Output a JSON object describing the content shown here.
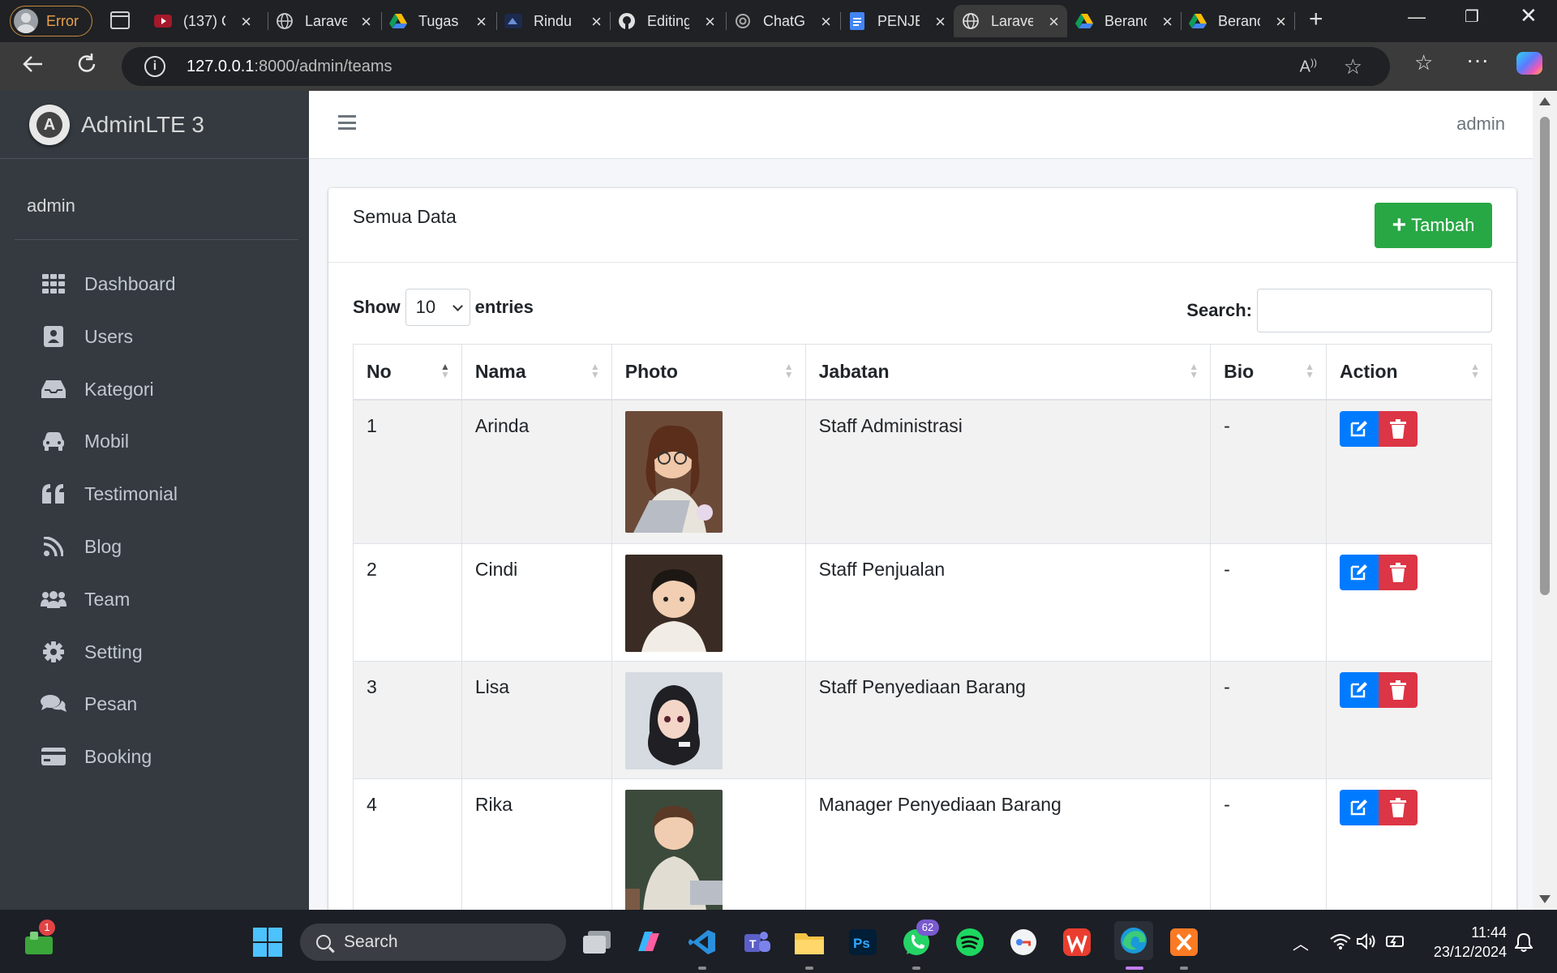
{
  "browser": {
    "profile_label": "Error",
    "tabs": [
      {
        "title": "(137) C",
        "favicon": "youtube-icon"
      },
      {
        "title": "Laravel",
        "favicon": "globe-icon"
      },
      {
        "title": "Tugas",
        "favicon": "drive-icon"
      },
      {
        "title": "Rindu",
        "favicon": "site-icon"
      },
      {
        "title": "Editing",
        "favicon": "github-icon"
      },
      {
        "title": "ChatG",
        "favicon": "chatgpt-icon"
      },
      {
        "title": "PENJE",
        "favicon": "docs-icon"
      },
      {
        "title": "Laravel",
        "favicon": "globe-icon",
        "active": true
      },
      {
        "title": "Beranda",
        "favicon": "drive-icon"
      },
      {
        "title": "Beranda",
        "favicon": "drive-icon"
      }
    ],
    "url_host": "127.0.0.1",
    "url_path": ":8000/admin/teams"
  },
  "app": {
    "brand": "AdminLTE 3",
    "sidebar_user": "admin",
    "nav_user": "admin",
    "nav": [
      {
        "label": "Dashboard",
        "icon": "dashboard-icon"
      },
      {
        "label": "Users",
        "icon": "user-card-icon"
      },
      {
        "label": "Kategori",
        "icon": "inbox-icon"
      },
      {
        "label": "Mobil",
        "icon": "car-icon"
      },
      {
        "label": "Testimonial",
        "icon": "quote-icon"
      },
      {
        "label": "Blog",
        "icon": "rss-icon"
      },
      {
        "label": "Team",
        "icon": "users-icon"
      },
      {
        "label": "Setting",
        "icon": "gear-icon"
      },
      {
        "label": "Pesan",
        "icon": "comments-icon"
      },
      {
        "label": "Booking",
        "icon": "credit-card-icon"
      }
    ]
  },
  "card": {
    "title": "Semua Data",
    "add_label": "Tambah",
    "show_label": "Show",
    "entries_value": "10",
    "entries_label": "entries",
    "search_label": "Search:",
    "search_value": ""
  },
  "table": {
    "headers": [
      "No",
      "Nama",
      "Photo",
      "Jabatan",
      "Bio",
      "Action"
    ],
    "rows": [
      {
        "no": "1",
        "nama": "Arinda",
        "jabatan": "Staff Administrasi",
        "bio": "-"
      },
      {
        "no": "2",
        "nama": "Cindi",
        "jabatan": "Staff Penjualan",
        "bio": "-"
      },
      {
        "no": "3",
        "nama": "Lisa",
        "jabatan": "Staff Penyediaan Barang",
        "bio": "-"
      },
      {
        "no": "4",
        "nama": "Rika",
        "jabatan": "Manager Penyediaan Barang",
        "bio": "-"
      }
    ]
  },
  "taskbar": {
    "search_label": "Search",
    "store_badge": "1",
    "whatsapp_badge": "62",
    "time": "11:44",
    "date": "23/12/2024"
  }
}
